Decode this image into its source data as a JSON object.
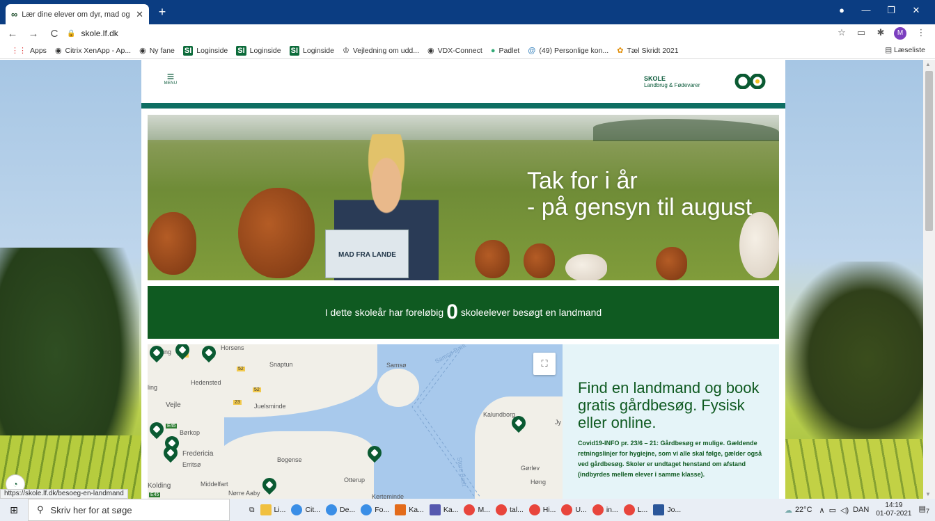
{
  "browser": {
    "tab_title": "Lær dine elever om dyr, mad og",
    "url": "skole.lf.dk",
    "avatar_letter": "M",
    "bookmarks": [
      "Apps",
      "Citrix XenApp - Ap...",
      "Ny fane",
      "Loginside",
      "Loginside",
      "Loginside",
      "Vejledning om udd...",
      "VDX-Connect",
      "Padlet",
      "(49) Personlige kon...",
      "Tæl Skridt 2021"
    ],
    "reading_list": "Læseliste",
    "status_url": "https://skole.lf.dk/besoeg-en-landmand"
  },
  "site": {
    "menu_label": "MENU",
    "brand_line1": "SKOLE",
    "brand_line2": "Landbrug & Fødevarer",
    "hero_line1": "Tak for i år",
    "hero_line2": "- på gensyn til august",
    "book_text": "MAD FRA LANDE",
    "counter_prefix": "I dette skoleår har foreløbig",
    "counter_value": "0",
    "counter_suffix": "skoleelever besøgt en landmand",
    "info_heading": "Find en landmand og book gratis gårdbesøg. Fysisk eller online.",
    "info_text": "Covid19-INFO pr. 23/6 – 21: Gårdbesøg er mulige. Gældende retningslinjer for hygiejne, som vi alle skal følge, gælder også ved gårdbesøg. Skoler er undtaget henstand om afstand (indbyrdes mellem elever i samme klasse)."
  },
  "map": {
    "places": [
      "Horsens",
      "Snaptun",
      "Samsø",
      "Hedensted",
      "Vejle",
      "Juelsminde",
      "Børkop",
      "Kalundborg",
      "Fredericia",
      "Erritsø",
      "Bogense",
      "Gørlev",
      "Otterup",
      "Høng",
      "Kolding",
      "Middelfart",
      "Nørre Aaby",
      "Kerteminde",
      "Samsø Bælt",
      "Store Bælt",
      "ling",
      "rring",
      "Jy"
    ],
    "roads": [
      "30",
      "52",
      "52",
      "23",
      "E45",
      "E45"
    ]
  },
  "taskbar": {
    "search_placeholder": "Skriv her for at søge",
    "apps": [
      "Li...",
      "Cit...",
      "De...",
      "Fo...",
      "Ka...",
      "Ka...",
      "M...",
      "tal...",
      "Hi...",
      "U...",
      "in...",
      "L...",
      "Jo..."
    ],
    "temperature": "22°C",
    "language": "DAN",
    "time": "14:19",
    "date": "01-07-2021",
    "notifications": "7"
  }
}
